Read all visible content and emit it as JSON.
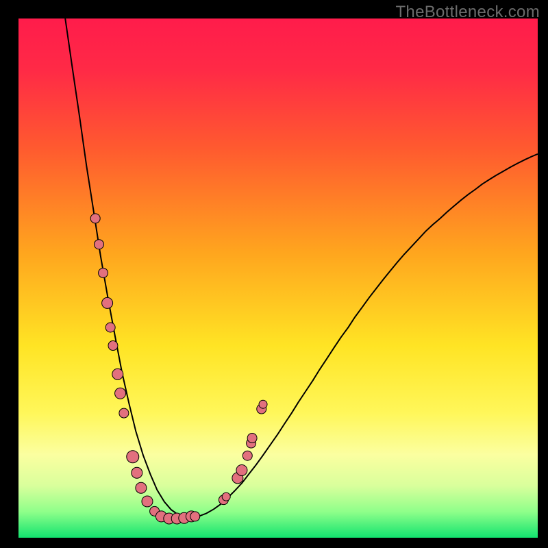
{
  "watermark": {
    "text": "TheBottleneck.com"
  },
  "chart_data": {
    "type": "line",
    "title": "",
    "xlabel": "",
    "ylabel": "",
    "xlim": [
      0,
      100
    ],
    "ylim": [
      0,
      100
    ],
    "gradient_stops": [
      {
        "pct": 0.0,
        "color": "#ff1c4b"
      },
      {
        "pct": 0.1,
        "color": "#ff2a46"
      },
      {
        "pct": 0.25,
        "color": "#ff5a2f"
      },
      {
        "pct": 0.45,
        "color": "#ffa51e"
      },
      {
        "pct": 0.63,
        "color": "#ffe424"
      },
      {
        "pct": 0.76,
        "color": "#fff75a"
      },
      {
        "pct": 0.84,
        "color": "#fbffa0"
      },
      {
        "pct": 0.9,
        "color": "#d9ff9c"
      },
      {
        "pct": 0.95,
        "color": "#8fff8a"
      },
      {
        "pct": 1.0,
        "color": "#12e36f"
      }
    ],
    "series": [
      {
        "name": "curve",
        "x": [
          9.0,
          10.4,
          11.8,
          13.1,
          14.5,
          15.8,
          17.2,
          18.6,
          19.9,
          21.3,
          22.6,
          24.0,
          25.4,
          26.7,
          28.1,
          29.4,
          30.8,
          32.2,
          33.5,
          34.9,
          36.2,
          37.6,
          39.0,
          40.3,
          41.7,
          43.1,
          44.4,
          45.8,
          47.1,
          48.5,
          49.9,
          51.2,
          52.6,
          53.9,
          55.3,
          56.7,
          58.0,
          59.4,
          60.7,
          62.1,
          63.5,
          64.8,
          66.2,
          67.5,
          68.9,
          70.3,
          71.6,
          73.0,
          74.3,
          75.7,
          77.1,
          78.4,
          79.8,
          81.2,
          82.5,
          83.9,
          85.2,
          86.6,
          88.0,
          89.3,
          90.7,
          92.0,
          93.4,
          94.8,
          96.1,
          97.5,
          98.8,
          100.0
        ],
        "y": [
          100.0,
          90.3,
          80.8,
          71.6,
          62.7,
          54.3,
          46.3,
          38.8,
          32.0,
          25.8,
          20.5,
          15.9,
          12.2,
          9.2,
          6.9,
          5.4,
          4.4,
          3.9,
          3.9,
          4.2,
          4.7,
          5.5,
          6.5,
          7.7,
          9.1,
          10.6,
          12.3,
          14.1,
          15.9,
          17.9,
          19.9,
          21.9,
          24.0,
          26.1,
          28.2,
          30.3,
          32.4,
          34.5,
          36.5,
          38.6,
          40.5,
          42.5,
          44.4,
          46.2,
          48.0,
          49.8,
          51.4,
          53.1,
          54.6,
          56.1,
          57.6,
          59.0,
          60.3,
          61.5,
          62.7,
          63.9,
          65.0,
          66.1,
          67.1,
          68.1,
          69.0,
          69.8,
          70.6,
          71.4,
          72.1,
          72.8,
          73.4,
          73.9
        ]
      }
    ],
    "markers": [
      {
        "x": 14.8,
        "y": 61.5,
        "r": 7
      },
      {
        "x": 15.5,
        "y": 56.5,
        "r": 7
      },
      {
        "x": 16.3,
        "y": 51.0,
        "r": 7
      },
      {
        "x": 17.1,
        "y": 45.2,
        "r": 8
      },
      {
        "x": 17.7,
        "y": 40.5,
        "r": 7
      },
      {
        "x": 18.2,
        "y": 37.0,
        "r": 7
      },
      {
        "x": 19.1,
        "y": 31.5,
        "r": 8
      },
      {
        "x": 19.6,
        "y": 27.8,
        "r": 8
      },
      {
        "x": 20.3,
        "y": 24.0,
        "r": 7
      },
      {
        "x": 22.0,
        "y": 15.6,
        "r": 9
      },
      {
        "x": 22.8,
        "y": 12.5,
        "r": 8
      },
      {
        "x": 23.6,
        "y": 9.6,
        "r": 8
      },
      {
        "x": 24.8,
        "y": 7.0,
        "r": 8
      },
      {
        "x": 26.2,
        "y": 5.1,
        "r": 7
      },
      {
        "x": 27.5,
        "y": 4.1,
        "r": 8
      },
      {
        "x": 29.0,
        "y": 3.7,
        "r": 8
      },
      {
        "x": 30.5,
        "y": 3.7,
        "r": 8
      },
      {
        "x": 31.9,
        "y": 3.8,
        "r": 8
      },
      {
        "x": 33.3,
        "y": 4.1,
        "r": 8
      },
      {
        "x": 34.0,
        "y": 4.1,
        "r": 7
      },
      {
        "x": 39.5,
        "y": 7.3,
        "r": 7
      },
      {
        "x": 40.0,
        "y": 7.9,
        "r": 6
      },
      {
        "x": 42.2,
        "y": 11.5,
        "r": 8
      },
      {
        "x": 43.0,
        "y": 13.0,
        "r": 8
      },
      {
        "x": 44.1,
        "y": 15.8,
        "r": 7
      },
      {
        "x": 44.8,
        "y": 18.2,
        "r": 7
      },
      {
        "x": 45.0,
        "y": 19.2,
        "r": 7
      },
      {
        "x": 46.8,
        "y": 24.8,
        "r": 7
      },
      {
        "x": 47.1,
        "y": 25.7,
        "r": 6
      }
    ],
    "marker_style": {
      "fill": "#e2707e",
      "stroke": "#000000",
      "stroke_width": 1
    },
    "curve_style": {
      "stroke": "#000000",
      "stroke_width": 2
    }
  }
}
